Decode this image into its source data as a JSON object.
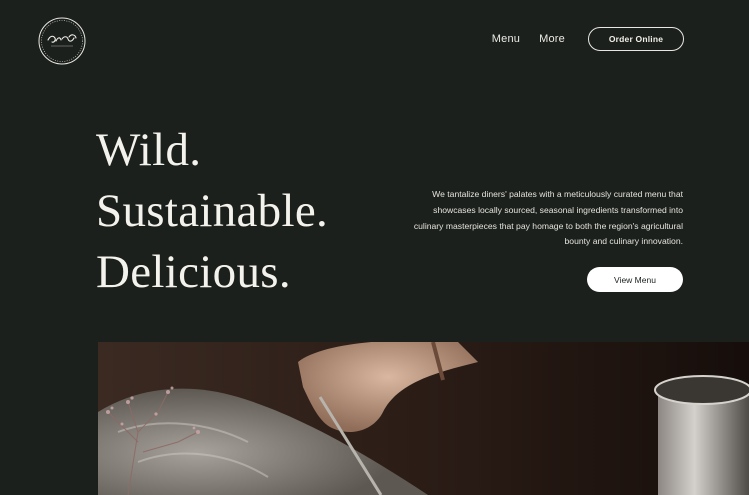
{
  "header": {
    "logo_text": "Flavor Spot",
    "logo_subtext": "BAR & BISTRO",
    "nav": [
      {
        "label": "Menu"
      },
      {
        "label": "More"
      }
    ],
    "order_button": "Order Online"
  },
  "hero": {
    "headline_lines": [
      "Wild.",
      "Sustainable.",
      "Delicious."
    ],
    "intro": "We tantalize diners' palates with a meticulously curated menu that showcases locally sourced, seasonal ingredients transformed into culinary masterpieces that pay homage to both the region's agricultural bounty and culinary innovation.",
    "cta_button": "View Menu"
  },
  "colors": {
    "background": "#1b201c",
    "text": "#f2f0ea",
    "button_fill": "#ffffff"
  },
  "icons": {
    "logo": "restaurant-logo-icon"
  }
}
